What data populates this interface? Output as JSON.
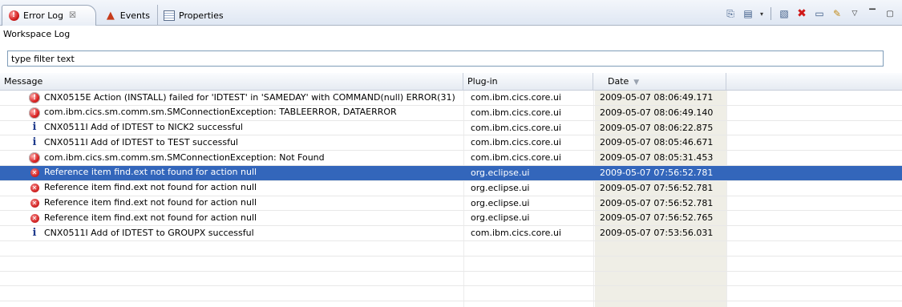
{
  "tabs": [
    {
      "label": "Error Log",
      "close": "☒",
      "icon": "error-log-icon",
      "active": true
    },
    {
      "label": "Events",
      "icon": "bell-icon",
      "active": false
    },
    {
      "label": "Properties",
      "icon": "properties-icon",
      "active": false
    }
  ],
  "subtitle": "Workspace Log",
  "filter": {
    "value": "type filter text"
  },
  "columns": {
    "message": "Message",
    "plugin": "Plug-in",
    "date": "Date"
  },
  "entries": [
    {
      "type": "error",
      "message": "CNX0515E Action (INSTALL) failed for 'IDTEST' in 'SAMEDAY' with COMMAND(null) ERROR(31)",
      "plugin": "com.ibm.cics.core.ui",
      "date": "2009-05-07 08:06:49.171"
    },
    {
      "type": "error",
      "message": "com.ibm.cics.sm.comm.sm.SMConnectionException: TABLEERROR, DATAERROR",
      "plugin": "com.ibm.cics.core.ui",
      "date": "2009-05-07 08:06:49.140"
    },
    {
      "type": "info",
      "message": "CNX0511I Add of IDTEST to NICK2 successful",
      "plugin": "com.ibm.cics.core.ui",
      "date": "2009-05-07 08:06:22.875"
    },
    {
      "type": "info",
      "message": "CNX0511I Add of IDTEST to TEST successful",
      "plugin": "com.ibm.cics.core.ui",
      "date": "2009-05-07 08:05:46.671"
    },
    {
      "type": "error",
      "message": "com.ibm.cics.sm.comm.sm.SMConnectionException: Not Found",
      "plugin": "com.ibm.cics.core.ui",
      "date": "2009-05-07 08:05:31.453"
    },
    {
      "type": "x",
      "message": "Reference item find.ext not found for action null",
      "plugin": "org.eclipse.ui",
      "date": "2009-05-07 07:56:52.781",
      "selected": true
    },
    {
      "type": "x",
      "message": "Reference item find.ext not found for action null",
      "plugin": "org.eclipse.ui",
      "date": "2009-05-07 07:56:52.781"
    },
    {
      "type": "x",
      "message": "Reference item find.ext not found for action null",
      "plugin": "org.eclipse.ui",
      "date": "2009-05-07 07:56:52.781"
    },
    {
      "type": "x",
      "message": "Reference item find.ext not found for action null",
      "plugin": "org.eclipse.ui",
      "date": "2009-05-07 07:56:52.765"
    },
    {
      "type": "info",
      "message": "CNX0511I Add of IDTEST to GROUPX successful",
      "plugin": "com.ibm.cics.core.ui",
      "date": "2009-05-07 07:53:56.031"
    }
  ],
  "toolbar": [
    "export-log-icon",
    "import-log-icon",
    "dropdown-icon",
    "clear-log-icon",
    "delete-log-icon",
    "open-log-icon",
    "restore-log-icon",
    "view-menu-icon",
    "minimize-icon",
    "maximize-icon"
  ],
  "colors": {
    "selection": "#3366bb",
    "date_column": "#efeee6",
    "info_icon": "#1f3b8c",
    "error_icon": "#d92020"
  }
}
